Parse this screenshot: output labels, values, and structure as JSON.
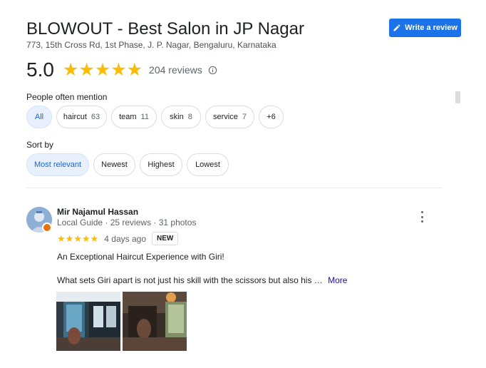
{
  "business": {
    "name": "BLOWOUT - Best Salon in JP Nagar",
    "address": "773, 15th Cross Rd, 1st Phase, J. P. Nagar, Bengaluru, Karnataka"
  },
  "write_review": {
    "label": "Write a review",
    "icon": "pencil-icon"
  },
  "rating": {
    "value": "5.0",
    "stars": 5,
    "count_label": "204 reviews",
    "star_color": "#fbbc04"
  },
  "mentions": {
    "label": "People often mention",
    "chips": [
      {
        "label": "All",
        "count": ""
      },
      {
        "label": "haircut",
        "count": "63"
      },
      {
        "label": "team",
        "count": "11"
      },
      {
        "label": "skin",
        "count": "8"
      },
      {
        "label": "service",
        "count": "7"
      },
      {
        "label": "+6",
        "count": ""
      }
    ]
  },
  "sort": {
    "label": "Sort by",
    "options": [
      "Most relevant",
      "Newest",
      "Highest",
      "Lowest"
    ],
    "selected": "Most relevant"
  },
  "review": {
    "author": "Mir Najamul Hassan",
    "meta": "Local Guide · 25 reviews · 31 photos",
    "stars": 5,
    "date": "4 days ago",
    "badge": "NEW",
    "title": "An Exceptional Haircut Experience with Giri!",
    "snippet": "What sets Giri apart is not just his skill with the scissors but also his …",
    "more_label": "More",
    "photo_count": 2
  },
  "colors": {
    "accent": "#1a73e8",
    "chip_active_bg": "#e8f0fe",
    "chip_active_text": "#1967d2",
    "local_guide_badge": "#e8710a"
  }
}
